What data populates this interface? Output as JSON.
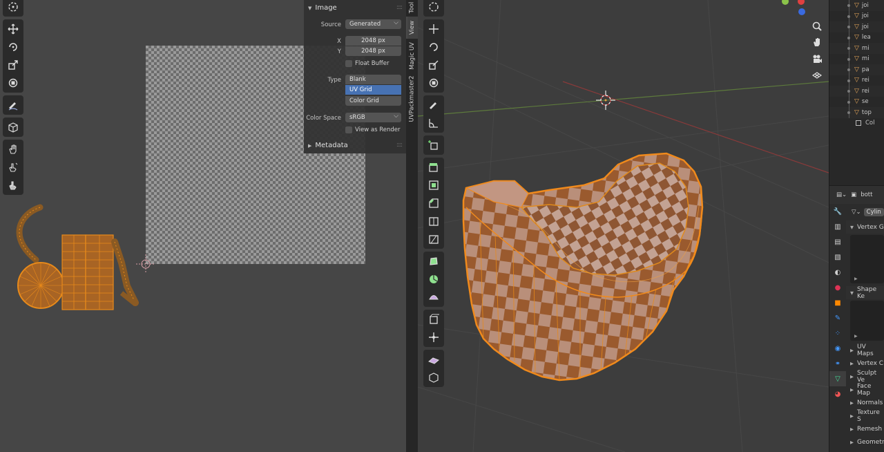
{
  "image_panel": {
    "title": "Image",
    "source_label": "Source",
    "source_value": "Generated",
    "x_label": "X",
    "x_value": "2048 px",
    "y_label": "Y",
    "y_value": "2048 px",
    "float_buffer_label": "Float Buffer",
    "type_label": "Type",
    "type_options": [
      "Blank",
      "UV Grid",
      "Color Grid"
    ],
    "type_selected": "UV Grid",
    "color_space_label": "Color Space",
    "color_space_value": "sRGB",
    "view_as_render_label": "View as Render",
    "metadata_title": "Metadata",
    "drag_handle": "::::"
  },
  "sidebar_tabs": [
    "Tool",
    "View",
    "Magic UV",
    "UVPackmaster2"
  ],
  "outliner": {
    "items": [
      "joi",
      "joi",
      "joi",
      "lea",
      "mi",
      "mi",
      "pa",
      "rei",
      "rei",
      "se",
      "top"
    ],
    "collection": "Col"
  },
  "properties": {
    "object_name": "bott",
    "mesh_name": "Cylin",
    "sections_open": [
      "Vertex G",
      "Shape Ke"
    ],
    "sections_closed": [
      "UV Maps",
      "Vertex C",
      "Sculpt Ve",
      "Face Map",
      "Normals",
      "Texture S",
      "Remesh",
      "Geometr"
    ]
  },
  "icons": {
    "uv_tools": [
      "cursor-icon",
      "move-icon",
      "rotate-icon",
      "scale-icon",
      "transform-icon",
      "annotate-icon",
      "box-select-icon",
      "grab-icon",
      "relax-icon",
      "pinch-icon"
    ],
    "viewport_tools": [
      "cursor-icon",
      "move-icon",
      "rotate-icon",
      "scale-icon",
      "transform-icon",
      "annotate-icon",
      "measure-icon",
      "add-cube-icon",
      "extrude-icon",
      "inset-icon",
      "bevel-icon",
      "loop-cut-icon",
      "knife-icon",
      "poly-build-icon",
      "spin-icon",
      "smooth-icon",
      "edge-slide-icon",
      "shrink-fatten-icon",
      "shear-icon",
      "rip-icon"
    ],
    "nav": [
      "zoom-icon",
      "hand-icon",
      "camera-icon",
      "grid-icon"
    ]
  },
  "colors": {
    "selection_orange": "#e88a1a",
    "active_enum": "#4772b3",
    "panel_bg": "#303030",
    "uv_bg": "#464646",
    "viewport_bg": "#3d3d3d"
  }
}
